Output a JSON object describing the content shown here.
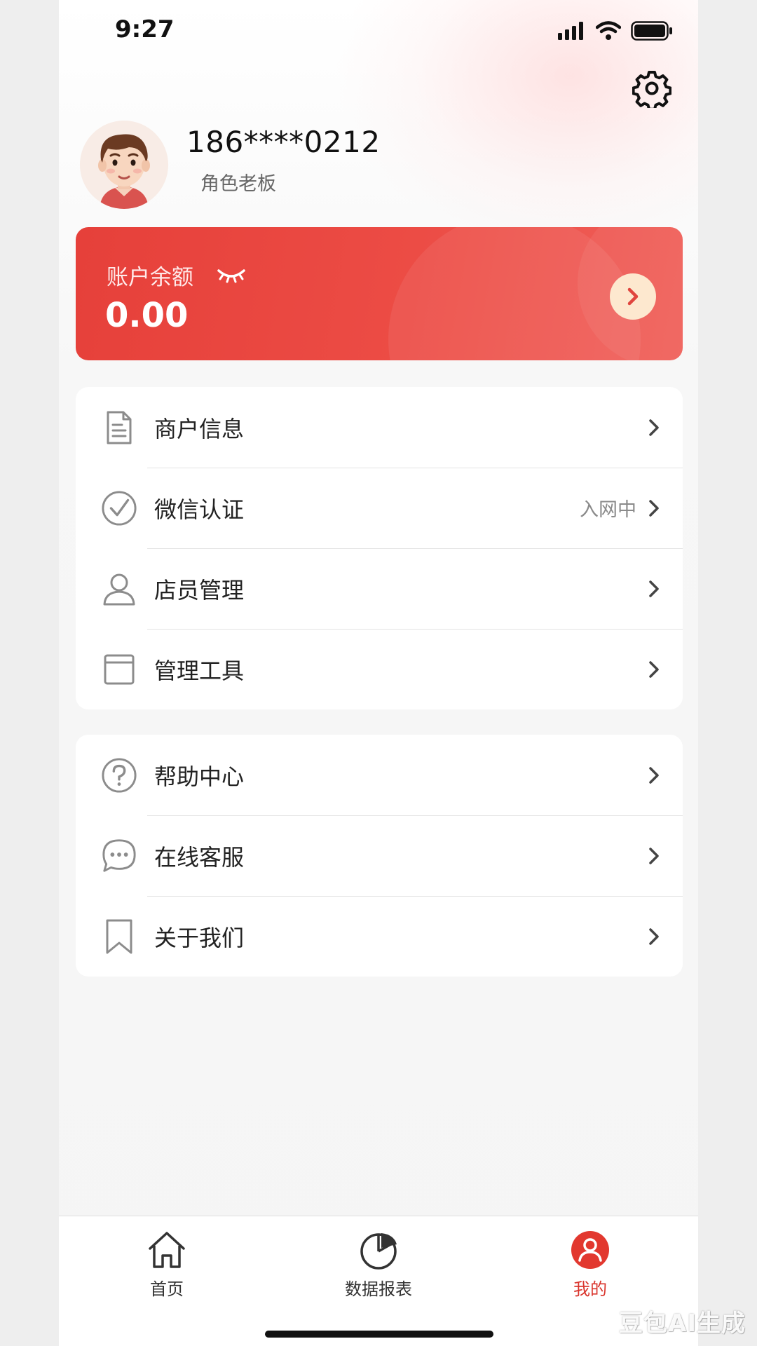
{
  "status_bar": {
    "time": "9:27",
    "icons": [
      "signal-icon",
      "wifi-icon",
      "battery-icon"
    ]
  },
  "header": {
    "settings_icon": "gear-icon"
  },
  "profile": {
    "phone": "186****0212",
    "role": "角色老板",
    "avatar_icon": "avatar-illustration"
  },
  "balance": {
    "label": "账户余额",
    "value": "0.00",
    "visibility_icon": "eye-closed-icon",
    "arrow_icon": "chevron-right-icon",
    "card_color": "#e6403a",
    "arrow_bg": "#fde8cf"
  },
  "menu_group_1": [
    {
      "label": "商户信息",
      "note": "",
      "icon": "document-icon"
    },
    {
      "label": "微信认证",
      "note": "入网中",
      "icon": "check-circle-icon"
    },
    {
      "label": "店员管理",
      "note": "",
      "icon": "user-icon"
    },
    {
      "label": "管理工具",
      "note": "",
      "icon": "window-icon"
    }
  ],
  "menu_group_2": [
    {
      "label": "帮助中心",
      "note": "",
      "icon": "help-circle-icon"
    },
    {
      "label": "在线客服",
      "note": "",
      "icon": "chat-bubble-icon"
    },
    {
      "label": "关于我们",
      "note": "",
      "icon": "bookmark-icon"
    }
  ],
  "tabbar": {
    "tabs": [
      {
        "label": "首页",
        "icon": "home-icon",
        "active": false
      },
      {
        "label": "数据报表",
        "icon": "pie-chart-icon",
        "active": false
      },
      {
        "label": "我的",
        "icon": "profile-icon",
        "active": true
      }
    ],
    "active_color": "#d9342c"
  },
  "watermark": "豆包AI生成"
}
